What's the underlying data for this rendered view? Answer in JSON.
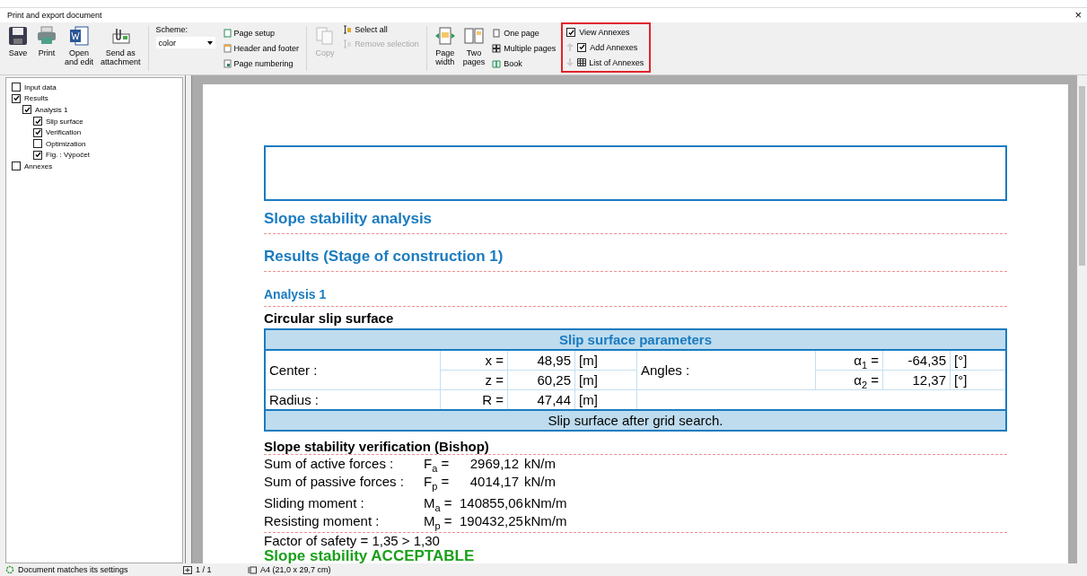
{
  "window": {
    "title": "Print and export document",
    "close": "×"
  },
  "ribbon": {
    "file_buttons": [
      {
        "kind": "save",
        "label": "Save"
      },
      {
        "kind": "print",
        "label": "Print"
      },
      {
        "kind": "word",
        "label": "Open\nand edit"
      },
      {
        "kind": "attach",
        "label": "Send as\nattachment"
      }
    ],
    "scheme": {
      "label": "Scheme:",
      "value": "color"
    },
    "page_links": [
      {
        "kind": "setup",
        "label": "Page setup"
      },
      {
        "kind": "header",
        "label": "Header and footer"
      },
      {
        "kind": "numbering",
        "label": "Page numbering"
      }
    ],
    "copy": {
      "label": "Copy",
      "disabled": true
    },
    "selection": [
      {
        "label": "Select all",
        "disabled": false
      },
      {
        "label": "Remove selection",
        "disabled": true
      }
    ],
    "view_buttons": [
      {
        "kind": "width",
        "label": "Page\nwidth"
      },
      {
        "kind": "two",
        "label": "Two\npages"
      }
    ],
    "view_links": [
      {
        "kind": "one",
        "label": "One page"
      },
      {
        "kind": "multiple",
        "label": "Multiple pages"
      },
      {
        "kind": "book",
        "label": "Book"
      }
    ],
    "annexes": {
      "highlighted": true,
      "view": {
        "label": "View Annexes",
        "checked": true
      },
      "add": {
        "label": "Add Annexes",
        "checked": true
      },
      "list": {
        "label": "List of Annexes"
      }
    }
  },
  "tree": [
    {
      "label": "Input data",
      "checked": false
    },
    {
      "label": "Results",
      "checked": true,
      "children": [
        {
          "label": "Analysis 1",
          "checked": true,
          "children": [
            {
              "label": "Slip surface",
              "checked": true
            },
            {
              "label": "Verification",
              "checked": true
            },
            {
              "label": "Optimization",
              "checked": false
            },
            {
              "label": "Fig. : Výpočet",
              "checked": true
            }
          ]
        }
      ]
    },
    {
      "label": "Annexes",
      "checked": false
    }
  ],
  "document": {
    "title": "Slope stability analysis",
    "stage": "Results (Stage of construction 1)",
    "analysis": "Analysis 1",
    "subtitle": "Circular slip surface",
    "parameters": {
      "title": "Slip surface parameters",
      "center_label": "Center :",
      "center": [
        {
          "symbol": "x =",
          "value": "48,95",
          "unit": "[m]"
        },
        {
          "symbol": "z =",
          "value": "60,25",
          "unit": "[m]"
        }
      ],
      "radius": {
        "label": "Radius :",
        "symbol": "R =",
        "value": "47,44",
        "unit": "[m]"
      },
      "angles_label": "Angles :",
      "angles": [
        {
          "symbol": "α$_{1}$ =",
          "value": "-64,35",
          "unit": "[°]"
        },
        {
          "symbol": "α$_{2}$ =",
          "value": "12,37",
          "unit": "[°]"
        }
      ],
      "note": "Slip surface after grid search."
    },
    "verification_title": "Slope stability verification (Bishop)",
    "forces": [
      {
        "label": "Sum of active forces :",
        "symbol": "F$_{a}$ =",
        "value": "2969,12",
        "unit": "kN/m"
      },
      {
        "label": "Sum of passive forces :",
        "symbol": "F$_{p}$ =",
        "value": "4014,17",
        "unit": "kN/m"
      }
    ],
    "moments": [
      {
        "label": "Sliding moment :",
        "symbol": "M$_{a}$ =",
        "value": "140855,06",
        "unit": "kNm/m"
      },
      {
        "label": "Resisting moment :",
        "symbol": "M$_{p}$ =",
        "value": "190432,25",
        "unit": "kNm/m"
      }
    ],
    "factor": "Factor of safety = 1,35 > 1,30",
    "result": "Slope stability ACCEPTABLE"
  },
  "status_bar": {
    "message": "Document matches its settings",
    "pages": "1 / 1",
    "paper": "A4 (21,0 x 29,7 cm)"
  }
}
